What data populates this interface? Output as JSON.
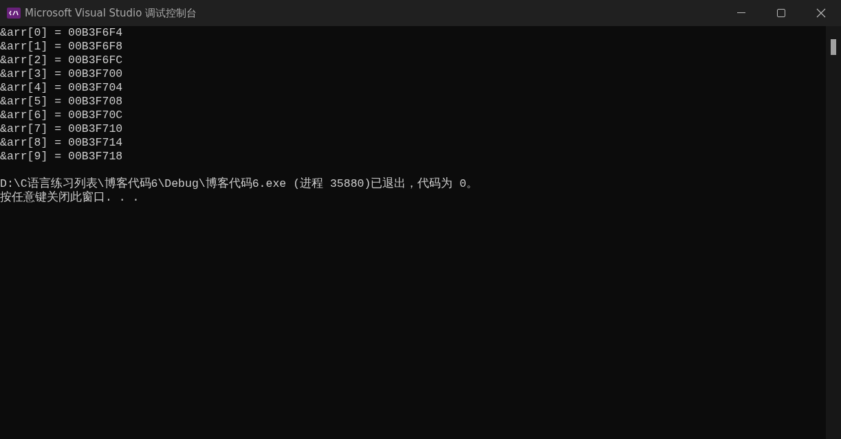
{
  "window": {
    "title": "Microsoft Visual Studio 调试控制台"
  },
  "console": {
    "output": [
      "&arr[0] = 00B3F6F4",
      "&arr[1] = 00B3F6F8",
      "&arr[2] = 00B3F6FC",
      "&arr[3] = 00B3F700",
      "&arr[4] = 00B3F704",
      "&arr[5] = 00B3F708",
      "&arr[6] = 00B3F70C",
      "&arr[7] = 00B3F710",
      "&arr[8] = 00B3F714",
      "&arr[9] = 00B3F718"
    ],
    "exit_message": [
      "D:\\C语言练习列表\\博客代码6\\Debug\\博客代码6.exe (进程 35880)已退出，代码为 0。",
      "按任意键关闭此窗口. . ."
    ]
  }
}
